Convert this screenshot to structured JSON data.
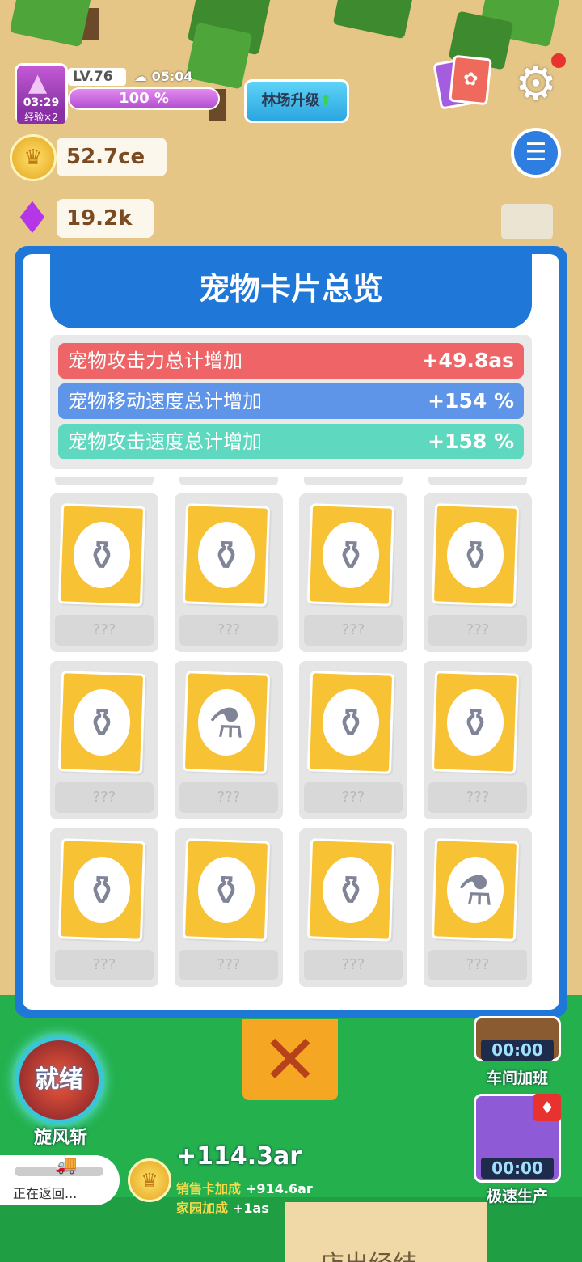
{
  "hud": {
    "avatar_timer": "03:29",
    "avatar_exp_badge": "经验×2",
    "level": "LV.76",
    "clock": "05:04",
    "xp_percent_text": "100 %",
    "xp_fill": 1.0,
    "upgrade_button": "林场升级",
    "coins": "52.7ce",
    "gems": "19.2k"
  },
  "modal": {
    "title": "宠物卡片总览",
    "stats": [
      {
        "label": "宠物攻击力总计增加",
        "value": "+49.8as",
        "color": "#ef6466"
      },
      {
        "label": "宠物移动速度总计增加",
        "value": "+154 %",
        "color": "#5f95e8"
      },
      {
        "label": "宠物攻击速度总计增加",
        "value": "+158 %",
        "color": "#5fd8c0"
      }
    ],
    "cards": [
      {
        "name": "???",
        "icon": "potion-flask"
      },
      {
        "name": "???",
        "icon": "potion-flask"
      },
      {
        "name": "???",
        "icon": "potion-flask"
      },
      {
        "name": "???",
        "icon": "potion-flask"
      },
      {
        "name": "???",
        "icon": "potion-flask"
      },
      {
        "name": "???",
        "icon": "potion-bottle"
      },
      {
        "name": "???",
        "icon": "potion-jar"
      },
      {
        "name": "???",
        "icon": "potion-flask"
      },
      {
        "name": "???",
        "icon": "potion-flask"
      },
      {
        "name": "???",
        "icon": "potion-flask"
      },
      {
        "name": "???",
        "icon": "potion-jar"
      },
      {
        "name": "???",
        "icon": "potion-vial"
      }
    ]
  },
  "skill": {
    "status": "就绪",
    "label": "旋风斩"
  },
  "side_buttons": [
    {
      "timer": "00:00",
      "label": "车间加班"
    },
    {
      "timer": "00:00",
      "label": "极速生产"
    }
  ],
  "return_status": "正在返回...",
  "income": {
    "main": "+114.3ar",
    "line1_key": "销售卡加成",
    "line1_value": "+914.6ar",
    "line2_key": "家园加成",
    "line2_value": "+1as"
  },
  "bottom_sign": "店出经结"
}
